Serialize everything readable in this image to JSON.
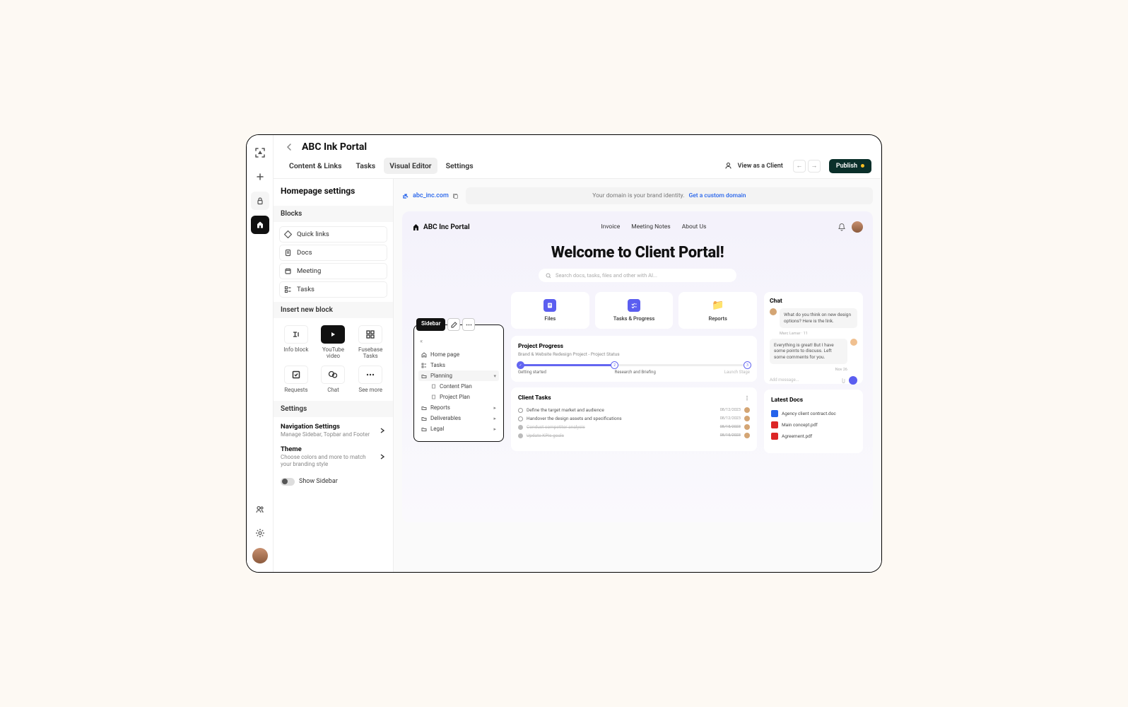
{
  "header": {
    "title": "ABC Ink Portal",
    "tabs": [
      "Content & Links",
      "Tasks",
      "Visual Editor",
      "Settings"
    ],
    "view_as": "View as a Client",
    "publish": "Publish"
  },
  "left": {
    "title": "Homepage settings",
    "blocks_head": "Blocks",
    "blocks": [
      "Quick links",
      "Docs",
      "Meeting",
      "Tasks"
    ],
    "insert_head": "Insert new block",
    "insert": [
      "Info block",
      "YouTube video",
      "Fusebase Tasks",
      "Requests",
      "Chat",
      "See more"
    ],
    "settings_head": "Settings",
    "nav_title": "Navigation Settings",
    "nav_sub": "Manage Sidebar, Topbar and Footer",
    "theme_title": "Theme",
    "theme_sub": "Choose colors and more to match your branding style",
    "show_sidebar": "Show Sidebar"
  },
  "url": {
    "domain": "abc_inc.com",
    "hint": "Your domain is your brand identity.",
    "cta": "Get a custom domain"
  },
  "preview": {
    "brand": "ABC Inc Portal",
    "nav": [
      "Invoice",
      "Meeting Notes",
      "About Us"
    ],
    "hero": "Welcome to Client Portal!",
    "search": "Search docs, tasks, files and other with AI...",
    "sidebar_tag": "Sidebar",
    "sidebar_items": {
      "home": "Home page",
      "tasks": "Tasks",
      "planning": "Planning",
      "content_plan": "Content Plan",
      "project_plan": "Project Plan",
      "reports": "Reports",
      "deliverables": "Deliverables",
      "legal": "Legal"
    },
    "quick_cards": [
      "Files",
      "Tasks & Progress",
      "Reports"
    ],
    "chat": {
      "title": "Chat",
      "msg1": "What do you think on new design options? Here is the link.",
      "meta1": "Marc Lamar · 11",
      "msg2": "Everything is great! But I have some points to discuss. Left some comments for you.",
      "meta2": "Nov 26",
      "placeholder": "Add message..."
    },
    "progress": {
      "title": "Project Progress",
      "sub": "Brand & Website Redesign Project - Project Status",
      "stages": [
        "Getting started",
        "Research and Briefing",
        "Launch Stage"
      ]
    },
    "tasks": {
      "title": "Client Tasks",
      "items": [
        {
          "t": "Define the target market and audience",
          "d": "08/12/2023",
          "done": false
        },
        {
          "t": "Handover the design assets and specifications",
          "d": "08/12/2023",
          "done": false
        },
        {
          "t": "Conduct competitor analysis",
          "d": "08/15/2023",
          "done": true
        },
        {
          "t": "Update KPIs goals",
          "d": "08/15/2023",
          "done": true
        }
      ]
    },
    "docs": {
      "title": "Latest Docs",
      "items": [
        {
          "n": "Agency client contract.doc",
          "k": "word"
        },
        {
          "n": "Main concept.pdf",
          "k": "pdf"
        },
        {
          "n": "Agreement.pdf",
          "k": "pdf"
        }
      ]
    }
  }
}
